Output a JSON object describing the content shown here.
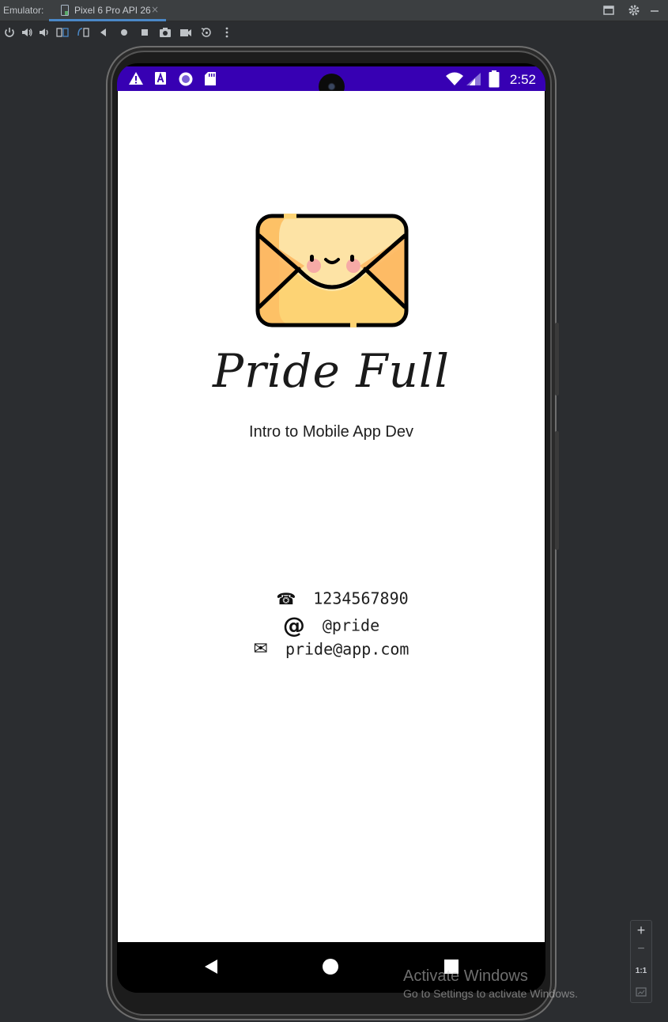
{
  "ide": {
    "emulator_label": "Emulator:",
    "tab_label": "Pixel 6 Pro API 26",
    "tab_close": "×"
  },
  "device": {
    "status_time": "2:52",
    "app": {
      "title": "Pride Full",
      "subtitle": "Intro to Mobile App Dev",
      "contacts": [
        {
          "icon": "☎",
          "text": "1234567890"
        },
        {
          "icon": "@",
          "text": "@pride"
        },
        {
          "icon": "✉",
          "text": "pride@app.com"
        }
      ]
    }
  },
  "zoom": {
    "plus": "+",
    "minus": "−",
    "one_to_one": "1:1"
  },
  "watermark": {
    "title": "Activate Windows",
    "subtitle": "Go to Settings to activate Windows."
  },
  "colors": {
    "status_bar": "#3700b3",
    "envelope_body": "#fdd374",
    "envelope_light": "#fde3a5",
    "envelope_side": "#fdb864",
    "cheek": "#f5a0a6"
  }
}
